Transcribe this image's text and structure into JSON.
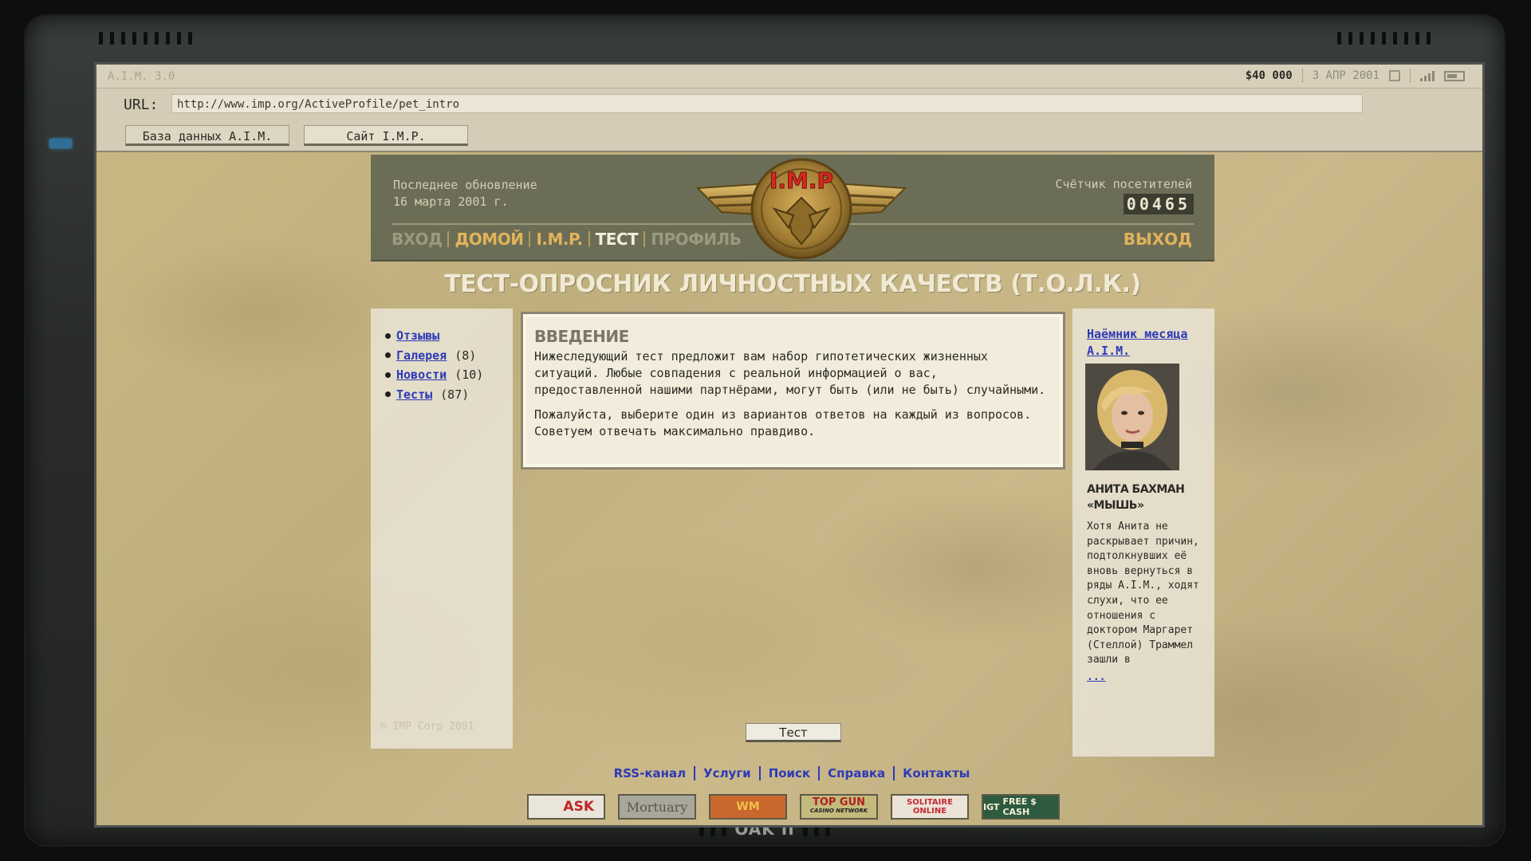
{
  "os": {
    "name": "A.I.M. 3.0",
    "balance": "$40 000",
    "date": "3 АПР 2001"
  },
  "browser": {
    "url_label": "URL:",
    "url": "http://www.imp.org/ActiveProfile/pet_intro",
    "tabs": [
      "База данных A.I.M.",
      "Сайт I.M.P."
    ]
  },
  "header": {
    "update_label": "Последнее обновление",
    "update_date": "16 марта 2001 г.",
    "visitor_label": "Счётчик посетителей",
    "visitor_count": "00465",
    "emblem_text": "I.M.P",
    "nav": [
      "ВХОД",
      "ДОМОЙ",
      "I.M.P.",
      "ТЕСТ",
      "ПРОФИЛЬ"
    ],
    "logout": "ВЫХОД"
  },
  "page_title": "ТЕСТ-ОПРОСНИК ЛИЧНОСТНЫХ КАЧЕСТВ (Т.О.Л.К.)",
  "sidebar": {
    "links": [
      {
        "label": "Отзывы",
        "count": ""
      },
      {
        "label": "Галерея",
        "count": "(8)"
      },
      {
        "label": "Новости",
        "count": "(10)"
      },
      {
        "label": "Тесты",
        "count": "(87)"
      }
    ],
    "copyright": "© IMP Corp 2001"
  },
  "intro": {
    "heading": "ВВЕДЕНИЕ",
    "paragraph1": "Нижеследующий тест предложит вам набор гипотетических жизненных ситуаций. Любые совпадения с реальной информацией о вас, предоставленной нашими партнёрами, могут быть (или не быть) случайными.",
    "paragraph2": "Пожалуйста, выберите один из вариантов ответов на каждый из вопросов. Советуем отвечать максимально правдиво."
  },
  "test_button": "Тест",
  "merc_of_month": {
    "link": "Наёмник месяца A.I.M.",
    "name_line1": "АНИТА БАХМАН",
    "name_line2": "«МЫШЬ»",
    "bio": "Хотя Анита не раскрывает причин, подтолкнувших её вновь вернуться в ряды A.I.M., ходят слухи, что ее отношения с доктором Маргарет (Стеллой) Траммел зашли в",
    "more": "..."
  },
  "footer_links": [
    "RSS-канал",
    "Услуги",
    "Поиск",
    "Справка",
    "Контакты"
  ],
  "ads": {
    "ask": "ASK",
    "mortuary": "Mortuary",
    "wm": "WM",
    "top_gun": "TOP GUN",
    "top_gun_sub": "CASINO NETWORK",
    "solitaire_1": "SOLITAIRE",
    "solitaire_2": "ONLINE",
    "cash_brand": "IGT",
    "cash_text": "FREE $ CASH"
  },
  "bezel": {
    "brand": "OAK II"
  }
}
